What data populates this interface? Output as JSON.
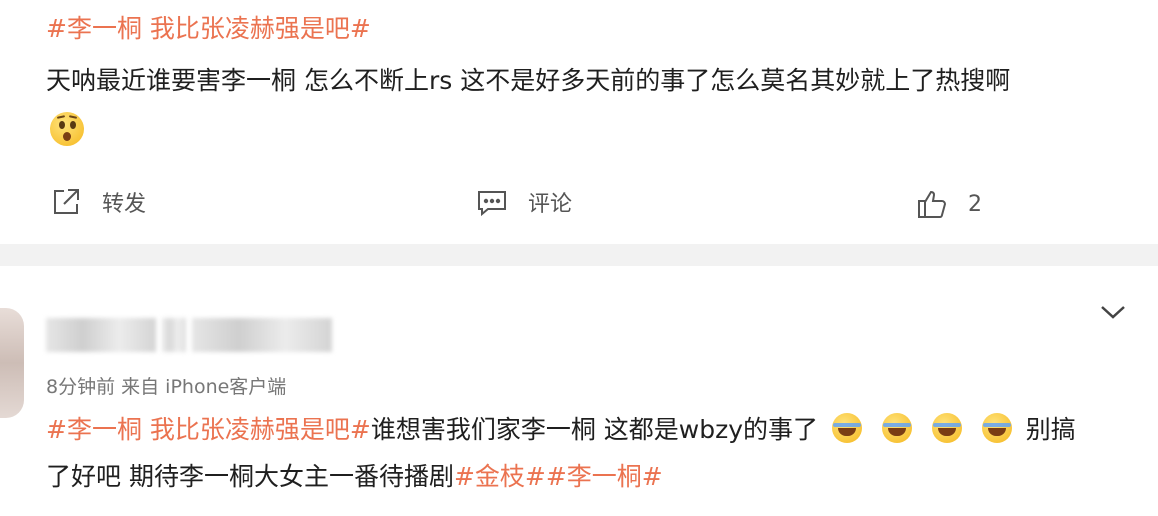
{
  "post1": {
    "topic": "#李一桐 我比张凌赫强是吧#",
    "text": "天呐最近谁要害李一桐 怎么不断上rs 这不是好多天前的事了怎么莫名其妙就上了热搜啊",
    "emoji": "surprised-emoji",
    "actions": {
      "repost_label": "转发",
      "comment_label": "评论",
      "like_count": "2"
    }
  },
  "post2": {
    "meta": "8分钟前  来自 iPhone客户端",
    "topic": "#李一桐 我比张凌赫强是吧#",
    "text_before": "谁想害我们家李一桐 这都是wbzy的事了",
    "emoji": "laughing-tears-emoji",
    "text_after": "别搞",
    "line2_text": "了好吧 期待李一桐大女主一番待播剧",
    "tag1": "#金枝#",
    "tag2": "#李一桐#"
  },
  "colors": {
    "topic": "#eb7350",
    "text": "#1f1f1f",
    "meta": "#777777",
    "separator": "#f2f2f2"
  }
}
